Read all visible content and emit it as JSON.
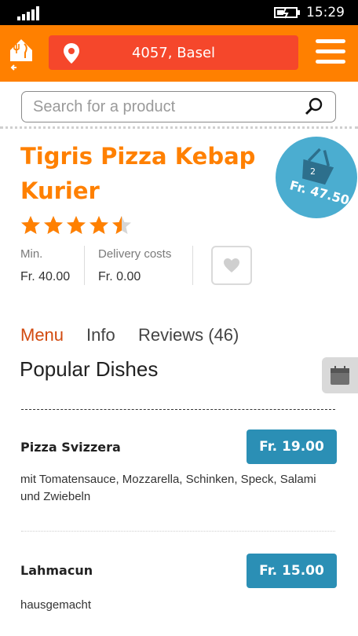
{
  "status_bar": {
    "time": "15:29"
  },
  "header": {
    "location": "4057, Basel",
    "colors": {
      "header_bg": "#ff8000",
      "location_bg": "#f5472b"
    }
  },
  "search": {
    "placeholder": "Search for a product"
  },
  "restaurant": {
    "name": "Tigris Pizza Kebap Kurier",
    "rating": 4.5,
    "rating_max": 5,
    "min_label": "Min.",
    "min_value": "Fr. 40.00",
    "delivery_label": "Delivery costs",
    "delivery_value": "Fr. 0.00"
  },
  "basket": {
    "count": "2",
    "total": "Fr. 47.50",
    "color": "#4badd0"
  },
  "tabs": [
    {
      "label": "Menu",
      "active": true
    },
    {
      "label": "Info",
      "active": false
    },
    {
      "label": "Reviews (46)",
      "active": false
    }
  ],
  "section": {
    "title": "Popular Dishes"
  },
  "dishes": [
    {
      "name": "Pizza Svizzera",
      "price": "Fr. 19.00",
      "description": "mit Tomatensauce, Mozzarella, Schinken, Speck, Salami und Zwiebeln"
    },
    {
      "name": "Lahmacun",
      "price": "Fr. 15.00",
      "description": "hausgemacht"
    }
  ],
  "icons": {
    "home": "home-back-icon",
    "location": "location-pin-icon",
    "menu": "hamburger-menu-icon",
    "search": "search-icon",
    "basket": "basket-icon",
    "favorite": "heart-icon",
    "side": "calendar-icon"
  }
}
